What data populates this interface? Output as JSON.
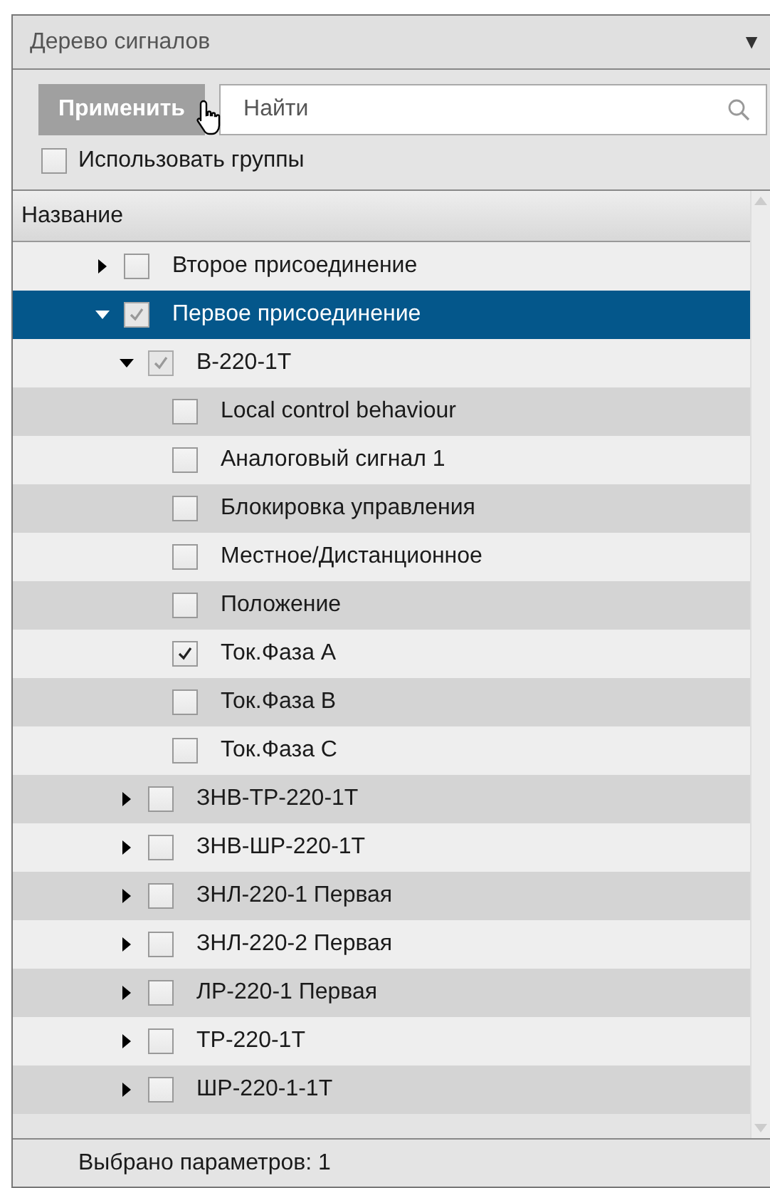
{
  "panel": {
    "title": "Дерево сигналов",
    "collapse_icon": "▼"
  },
  "toolbar": {
    "apply_button": "Применить",
    "search": {
      "placeholder": "Найти"
    },
    "use_groups": {
      "label": "Использовать группы",
      "checked": false
    }
  },
  "tree": {
    "column": "Название",
    "items": [
      {
        "label": "Второе присоединение",
        "checked": false,
        "disabled": false,
        "expanded": false,
        "selected": false
      },
      {
        "label": "Первое присоединение",
        "checked": true,
        "disabled": true,
        "expanded": true,
        "selected": true,
        "children": [
          {
            "label": "В-220-1Т",
            "checked": true,
            "disabled": true,
            "expanded": true,
            "selected": false,
            "children": [
              {
                "label": "Local control behaviour",
                "checked": false,
                "disabled": false,
                "selected": false
              },
              {
                "label": "Аналоговый сигнал 1",
                "checked": false,
                "disabled": false,
                "selected": false
              },
              {
                "label": "Блокировка управления",
                "checked": false,
                "disabled": false,
                "selected": false
              },
              {
                "label": "Местное/Дистанционное",
                "checked": false,
                "disabled": false,
                "selected": false
              },
              {
                "label": "Положение",
                "checked": false,
                "disabled": false,
                "selected": false
              },
              {
                "label": "Ток.Фаза A",
                "checked": true,
                "disabled": false,
                "selected": false
              },
              {
                "label": "Ток.Фаза B",
                "checked": false,
                "disabled": false,
                "selected": false
              },
              {
                "label": "Ток.Фаза C",
                "checked": false,
                "disabled": false,
                "selected": false
              }
            ]
          },
          {
            "label": "ЗНВ-ТР-220-1Т",
            "checked": false,
            "disabled": false,
            "expanded": false,
            "selected": false
          },
          {
            "label": "ЗНВ-ШР-220-1Т",
            "checked": false,
            "disabled": false,
            "expanded": false,
            "selected": false
          },
          {
            "label": "ЗНЛ-220-1 Первая",
            "checked": false,
            "disabled": false,
            "expanded": false,
            "selected": false
          },
          {
            "label": "ЗНЛ-220-2 Первая",
            "checked": false,
            "disabled": false,
            "expanded": false,
            "selected": false
          },
          {
            "label": "ЛР-220-1 Первая",
            "checked": false,
            "disabled": false,
            "expanded": false,
            "selected": false
          },
          {
            "label": "ТР-220-1Т",
            "checked": false,
            "disabled": false,
            "expanded": false,
            "selected": false
          },
          {
            "label": "ШР-220-1-1Т",
            "checked": false,
            "disabled": false,
            "expanded": false,
            "selected": false
          }
        ]
      }
    ]
  },
  "status_bar": "Выбрано параметров: 1"
}
